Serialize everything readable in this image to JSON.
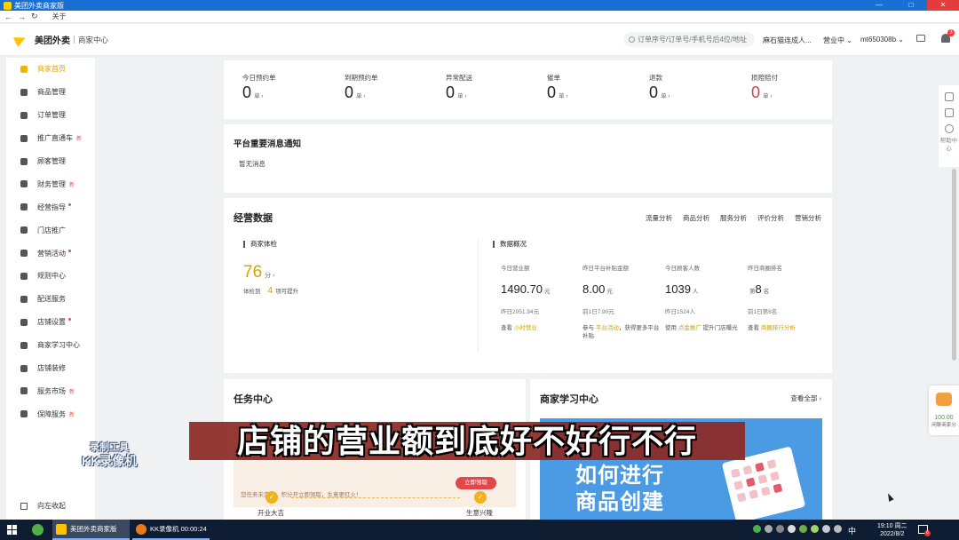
{
  "window": {
    "title": "美团外卖商家版",
    "controls": [
      "—",
      "□",
      "✕"
    ]
  },
  "browser": {
    "back": "←",
    "forward": "→",
    "reload": "↻",
    "about_label": "关于"
  },
  "header": {
    "brand": "美团外卖",
    "subtitle": "商家中心",
    "search_placeholder": "订单序号/订单号/手机号后4位/地址",
    "shop_name": "麻石猫连成人...",
    "status": "营业中",
    "account": "mt650308b",
    "notification_count": "3"
  },
  "sidebar": {
    "items": [
      {
        "label": "商家首页",
        "active": true
      },
      {
        "label": "商品管理"
      },
      {
        "label": "订单管理"
      },
      {
        "label": "推广直通车",
        "badge": "新"
      },
      {
        "label": "顾客管理"
      },
      {
        "label": "财务管理",
        "badge": "新"
      },
      {
        "label": "经营指导",
        "dot": true
      },
      {
        "label": "门店推广"
      },
      {
        "label": "营销活动",
        "dot": true
      },
      {
        "label": "规则中心"
      },
      {
        "label": "配送服务"
      },
      {
        "label": "店铺设置",
        "dot": true
      },
      {
        "label": "商家学习中心"
      },
      {
        "label": "店铺装修"
      },
      {
        "label": "服务市场",
        "badge": "新"
      },
      {
        "label": "保障服务",
        "badge": "新"
      }
    ],
    "bottom_label": "向左收起"
  },
  "stats": [
    {
      "label": "今日预约单",
      "value": "0",
      "unit": "单 ›"
    },
    {
      "label": "到期预约单",
      "value": "0",
      "unit": "单 ›"
    },
    {
      "label": "异常配送",
      "value": "0",
      "unit": "单 ›"
    },
    {
      "label": "催单",
      "value": "0",
      "unit": "单 ›"
    },
    {
      "label": "退款",
      "value": "0",
      "unit": "单 ›"
    },
    {
      "label": "损赔赔付",
      "value": "0",
      "unit": "单 ›",
      "red": true
    }
  ],
  "notice": {
    "title": "平台重要消息通知",
    "empty": "暂无消息"
  },
  "operations": {
    "title": "经营数据",
    "tabs": [
      "流量分析",
      "商品分析",
      "服务分析",
      "评价分析",
      "营销分析"
    ],
    "health": {
      "section": "商家体检",
      "score": "76",
      "score_unit": "分 ›",
      "sub_label": "体检到",
      "count": "4",
      "count_label": "项可提升"
    },
    "overview": {
      "section": "数据概况",
      "metrics": [
        {
          "label": "今日营业额",
          "value": "1490.70",
          "unit": "元",
          "yesterday": "昨日2051.94元",
          "tip_a": "查看 ",
          "tip_link": "小时营业",
          "tip_b": ""
        },
        {
          "label": "昨日平台补贴金额",
          "value": "8.00",
          "unit": "元",
          "yesterday": "前1日7.90元",
          "tip_a": "参与 ",
          "tip_link": "平台活动",
          "tip_b": "，获得更多平台补贴"
        },
        {
          "label": "今日顾客人数",
          "value": "1039",
          "unit": "人",
          "yesterday": "昨日1524人",
          "tip_a": "使用 ",
          "tip_link": "点金推广",
          "tip_b": " 提升门店曝光"
        },
        {
          "label": "昨日商圈排名",
          "value": "8",
          "unit": "名",
          "prefix": "第",
          "yesterday": "前1日第8名",
          "tip_a": "查看 ",
          "tip_link": "商圈排行分析",
          "tip_b": ""
        }
      ]
    }
  },
  "tasks": {
    "title": "任务中心",
    "banner_text": "您任务未完成，积分开立即领取，生意更红火！",
    "banner_button": "立即领取",
    "steps": [
      "开业大吉",
      "生意兴隆"
    ]
  },
  "learning": {
    "title": "商家学习中心",
    "view_all": "查看全部 ›",
    "promo_line1": "如何进行",
    "promo_line2": "商品创建"
  },
  "rail": {
    "help_label": "帮助中心"
  },
  "chat_widget": {
    "value": "100.00",
    "label": "闲聊商家分"
  },
  "watermark": {
    "line1": "录制工具",
    "line2": "KK录像机"
  },
  "subtitle": "店铺的营业额到底好不好行不行",
  "taskbar": {
    "app1": "美团外卖商家版",
    "app2": "KK录像机 00:00:24",
    "ime": "中",
    "time": "19:10 周二",
    "date": "2022/8/2",
    "notif_count": "6"
  }
}
